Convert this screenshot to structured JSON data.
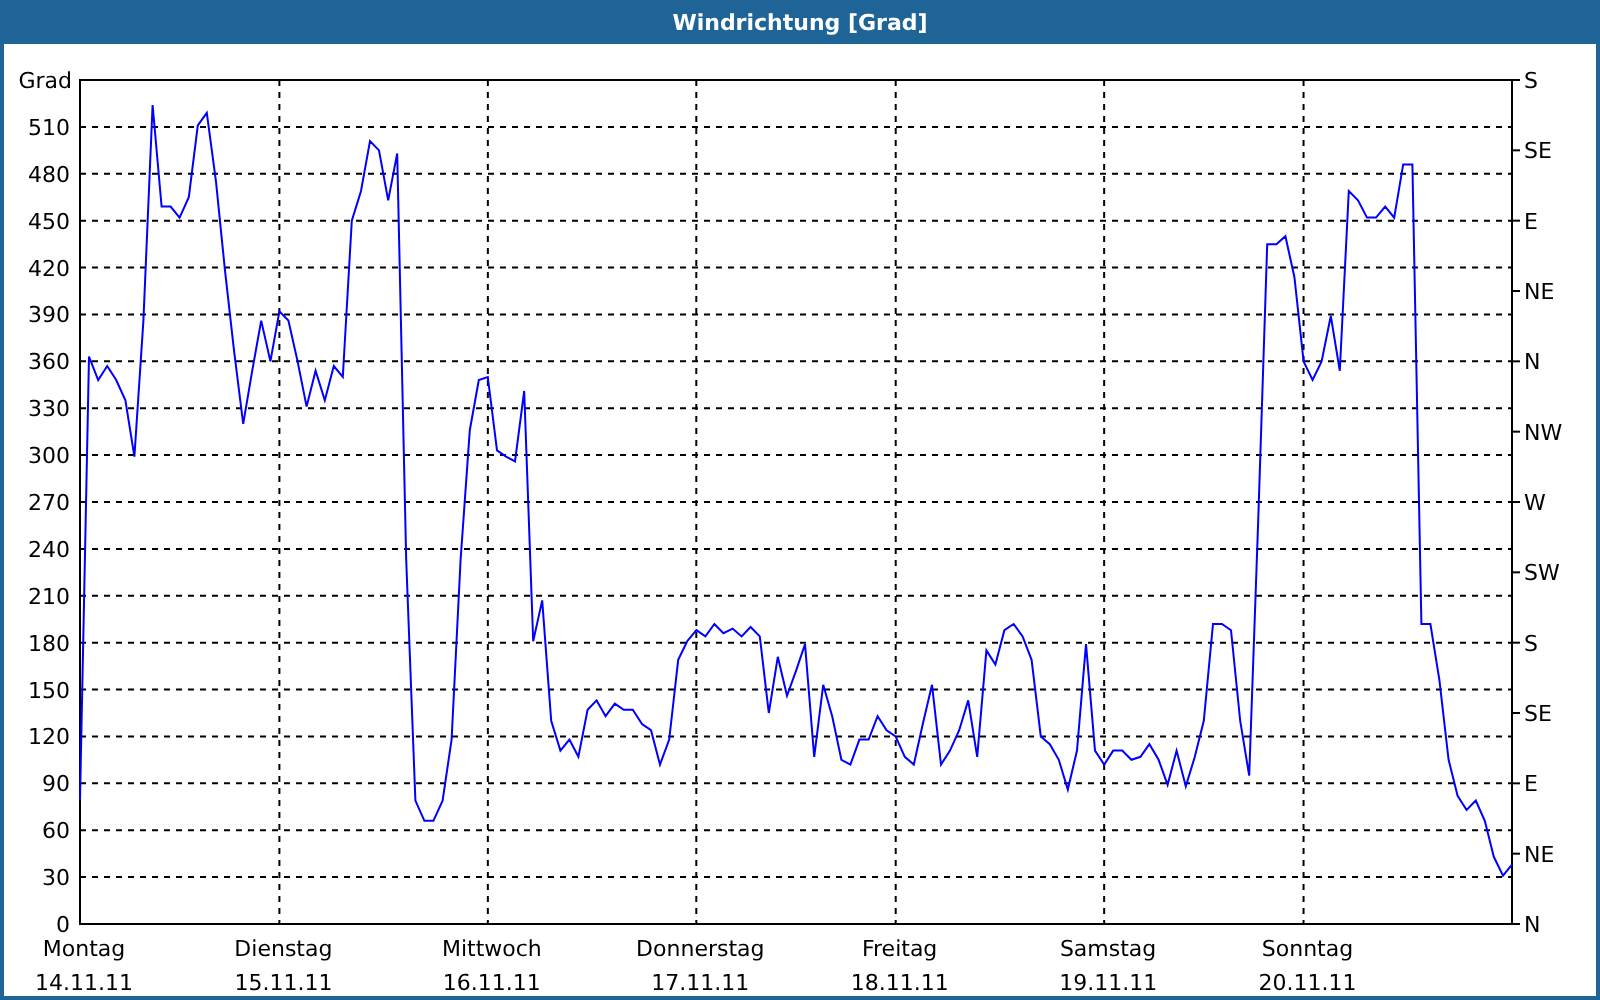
{
  "window": {
    "title": "Windrichtung [Grad]"
  },
  "panel": {
    "chart_data": {
      "type": "line",
      "grid": true,
      "ylabel": "Grad",
      "ylim": [
        0,
        540
      ],
      "yticks": [
        0,
        30,
        60,
        90,
        120,
        150,
        180,
        210,
        240,
        270,
        300,
        330,
        360,
        390,
        420,
        450,
        480,
        510
      ],
      "categories": [
        "14.11.11",
        null,
        null,
        null,
        null,
        null,
        null,
        null,
        null,
        null,
        null,
        null,
        null,
        null,
        null,
        null,
        null,
        null,
        null,
        null,
        null,
        null,
        "15.11.11",
        null,
        null,
        null,
        null,
        null,
        null,
        null,
        null,
        null,
        null,
        null,
        null,
        null,
        null,
        null,
        null,
        null,
        null,
        null,
        null,
        null,
        null,
        "16.11.11",
        null,
        null,
        null,
        null,
        null,
        null,
        null,
        null,
        null,
        null,
        null,
        null,
        null,
        null,
        null,
        null,
        null,
        null,
        null,
        null,
        null,
        null,
        "17.11.11",
        null,
        null,
        null,
        null,
        null,
        null,
        null,
        null,
        null,
        null,
        null,
        null,
        null,
        null,
        null,
        null,
        null,
        null,
        null,
        null,
        null,
        "18.11.11",
        null,
        null,
        null,
        null,
        null,
        null,
        null,
        null,
        null,
        null,
        null,
        null,
        null,
        null,
        null,
        null,
        null,
        null,
        null,
        null,
        null,
        null,
        "19.11.11",
        null,
        null,
        null,
        null,
        null,
        null,
        null,
        null,
        null,
        null,
        null,
        null,
        null,
        null,
        null,
        null,
        null,
        null,
        null,
        null,
        null,
        "20.11.11",
        null,
        null,
        null,
        null,
        null,
        null,
        null,
        null,
        null,
        null,
        null,
        null,
        null,
        null,
        null,
        null,
        null,
        null,
        null,
        null,
        null,
        null,
        null
      ],
      "series": [
        {
          "color": "#0000ff",
          "values": [
            79,
            363,
            348,
            357,
            348,
            335,
            299,
            386,
            524,
            459,
            459,
            452,
            465,
            511,
            519,
            475,
            418,
            367,
            320,
            354,
            386,
            360,
            392,
            386,
            360,
            331,
            354,
            335,
            357,
            350,
            450,
            469,
            501,
            495,
            463,
            493,
            233,
            79,
            66,
            66,
            79,
            118,
            233,
            316,
            348,
            350,
            303,
            299,
            296,
            341,
            181,
            207,
            130,
            111,
            118,
            107,
            137,
            143,
            133,
            141,
            137,
            137,
            128,
            124,
            102,
            118,
            169,
            181,
            188,
            184,
            192,
            186,
            189,
            184,
            190,
            184,
            135,
            171,
            146,
            162,
            179,
            107,
            153,
            133,
            105,
            102,
            118,
            118,
            133,
            124,
            120,
            107,
            102,
            128,
            153,
            102,
            111,
            124,
            143,
            107,
            175,
            166,
            188,
            192,
            184,
            169,
            120,
            115,
            105,
            86,
            111,
            179,
            111,
            102,
            111,
            111,
            105,
            107,
            115,
            105,
            89,
            111,
            88,
            107,
            130,
            192,
            192,
            188,
            130,
            95,
            258,
            435,
            435,
            440,
            414,
            360,
            348,
            360,
            389,
            354,
            469,
            463,
            452,
            452,
            459,
            452,
            486,
            486,
            192,
            192,
            156,
            105,
            82,
            73,
            79,
            66,
            43,
            31,
            38
          ]
        }
      ]
    },
    "tick_days": [
      "Montag",
      "Dienstag",
      "Mittwoch",
      "Donnerstag",
      "Freitag",
      "Samstag",
      "Sonntag"
    ],
    "compass_ticks": [
      "S",
      "SE",
      "E",
      "NE",
      "N",
      "NW",
      "W",
      "SW",
      "S",
      "SE",
      "E",
      "NE",
      "N"
    ]
  }
}
